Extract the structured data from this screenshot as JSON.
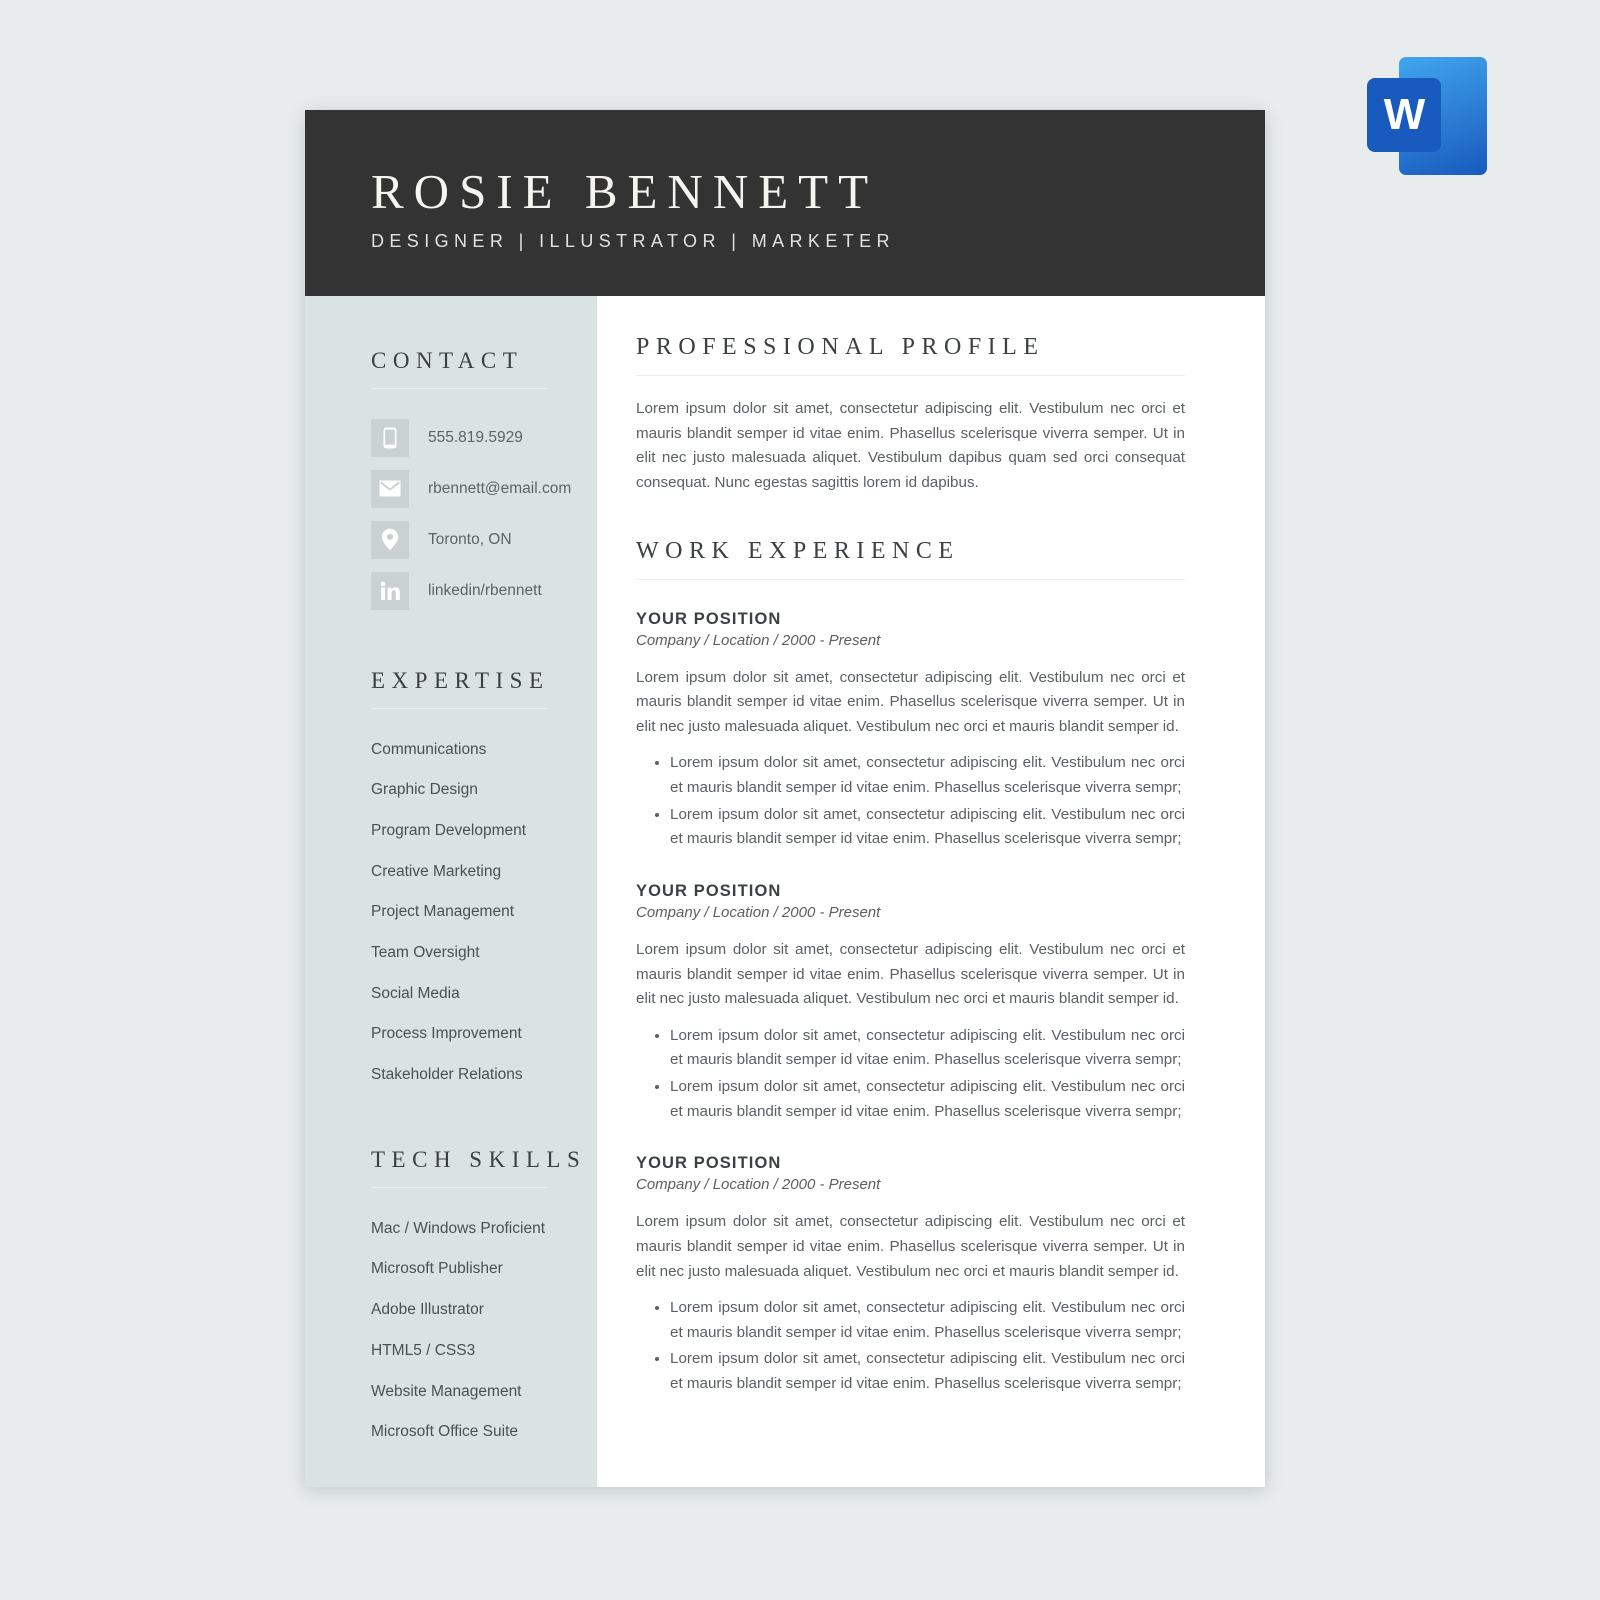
{
  "app_icon": {
    "name": "microsoft-word",
    "letter": "W",
    "back_color": "#2b7cd3",
    "front_color": "#185abd"
  },
  "resume": {
    "header": {
      "name": "ROSIE BENNETT",
      "tagline": "DESIGNER  |  ILLUSTRATOR  |  MARKETER",
      "background_color": "#333333"
    },
    "sidebar": {
      "background_color": "#dbe2e2",
      "contact": {
        "heading": "CONTACT",
        "items": [
          {
            "icon": "phone-icon",
            "value": "555.819.5929"
          },
          {
            "icon": "email-icon",
            "value": "rbennett@email.com"
          },
          {
            "icon": "location-pin-icon",
            "value": "Toronto, ON"
          },
          {
            "icon": "linkedin-icon",
            "value": "linkedin/rbennett"
          }
        ]
      },
      "expertise": {
        "heading": "EXPERTISE",
        "items": [
          "Communications",
          "Graphic Design",
          "Program Development",
          "Creative Marketing",
          "Project Management",
          "Team Oversight",
          "Social Media",
          "Process Improvement",
          "Stakeholder Relations"
        ]
      },
      "tech_skills": {
        "heading": "TECH SKILLS",
        "items": [
          "Mac / Windows Proficient",
          "Microsoft Publisher",
          "Adobe Illustrator",
          "HTML5 / CSS3",
          "Website Management",
          "Microsoft Office Suite"
        ]
      }
    },
    "main": {
      "profile": {
        "heading": "PROFESSIONAL PROFILE",
        "body": "Lorem ipsum dolor sit amet, consectetur adipiscing elit. Vestibulum nec orci et mauris blandit semper id vitae enim. Phasellus scelerisque viverra semper. Ut in elit nec justo malesuada aliquet. Vestibulum dapibus quam sed orci consequat consequat. Nunc egestas sagittis lorem id dapibus."
      },
      "work_experience": {
        "heading": "WORK EXPERIENCE",
        "jobs": [
          {
            "title": "YOUR POSITION",
            "meta": "Company  / Location / 2000 - Present",
            "body": "Lorem ipsum dolor sit amet, consectetur adipiscing elit. Vestibulum nec orci et mauris blandit semper id vitae enim. Phasellus scelerisque viverra semper. Ut in elit nec justo malesuada aliquet. Vestibulum nec orci et mauris blandit semper id.",
            "bullets": [
              "Lorem ipsum dolor sit amet, consectetur adipiscing elit. Vestibulum nec orci et mauris blandit semper id vitae enim. Phasellus scelerisque viverra sempr;",
              "Lorem ipsum dolor sit amet, consectetur adipiscing elit. Vestibulum nec orci et mauris blandit semper id vitae enim. Phasellus scelerisque viverra sempr;"
            ]
          },
          {
            "title": "YOUR POSITION",
            "meta": "Company  / Location / 2000 - Present",
            "body": "Lorem ipsum dolor sit amet, consectetur adipiscing elit. Vestibulum nec orci et mauris blandit semper id vitae enim. Phasellus scelerisque viverra semper. Ut in elit nec justo malesuada aliquet. Vestibulum nec orci et mauris blandit semper id.",
            "bullets": [
              "Lorem ipsum dolor sit amet, consectetur adipiscing elit. Vestibulum nec orci et mauris blandit semper id vitae enim. Phasellus scelerisque viverra sempr;",
              "Lorem ipsum dolor sit amet, consectetur adipiscing elit. Vestibulum nec orci et mauris blandit semper id vitae enim. Phasellus scelerisque viverra sempr;"
            ]
          },
          {
            "title": "YOUR POSITION",
            "meta": "Company  / Location / 2000 - Present",
            "body": "Lorem ipsum dolor sit amet, consectetur adipiscing elit. Vestibulum nec orci et mauris blandit semper id vitae enim. Phasellus scelerisque viverra semper. Ut in elit nec justo malesuada aliquet. Vestibulum nec orci et mauris blandit semper id.",
            "bullets": [
              "Lorem ipsum dolor sit amet, consectetur adipiscing elit. Vestibulum nec orci et mauris blandit semper id vitae enim. Phasellus scelerisque viverra sempr;",
              "Lorem ipsum dolor sit amet, consectetur adipiscing elit. Vestibulum nec orci et mauris blandit semper id vitae enim. Phasellus scelerisque viverra sempr;"
            ]
          }
        ]
      }
    }
  }
}
